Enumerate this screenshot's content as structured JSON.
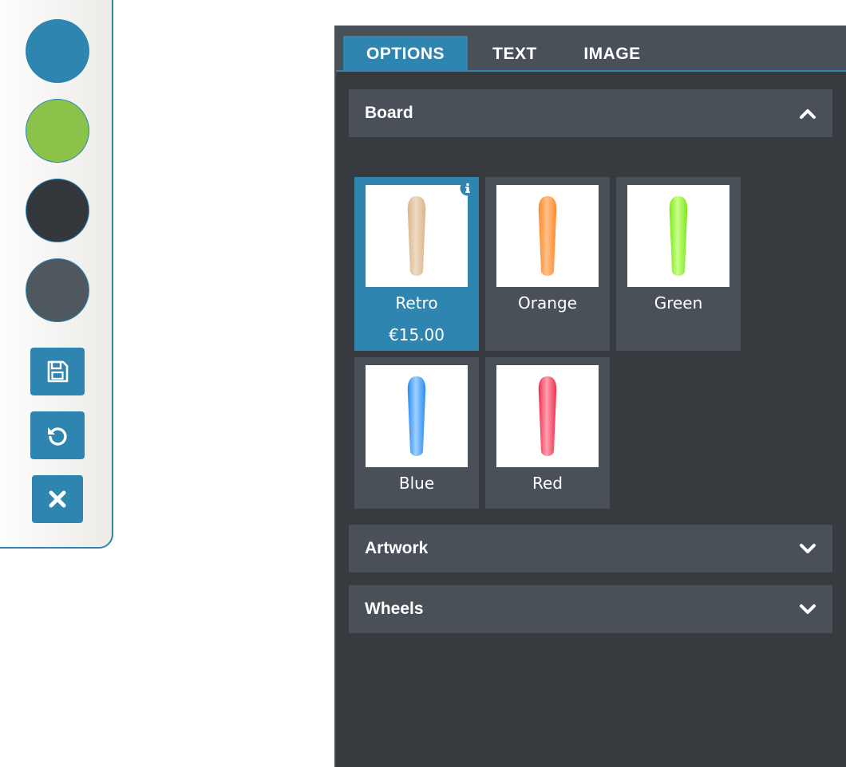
{
  "toolbar": {
    "swatches": [
      {
        "name": "blue",
        "color": "#2e86b0"
      },
      {
        "name": "green",
        "color": "#8bc34a"
      },
      {
        "name": "dark",
        "color": "#33373c"
      },
      {
        "name": "gray",
        "color": "#50585f"
      }
    ],
    "buttons": [
      {
        "icon": "save-icon"
      },
      {
        "icon": "undo-icon"
      },
      {
        "icon": "close-icon"
      }
    ],
    "accent_color": "#2e86b0"
  },
  "tabs": [
    {
      "label": "OPTIONS",
      "active": true
    },
    {
      "label": "TEXT",
      "active": false
    },
    {
      "label": "IMAGE",
      "active": false
    }
  ],
  "accordion": [
    {
      "title": "Board",
      "expanded": true
    },
    {
      "title": "Artwork",
      "expanded": false
    },
    {
      "title": "Wheels",
      "expanded": false
    }
  ],
  "board_options": [
    {
      "label": "Retro",
      "price": "€15.00",
      "selected": true,
      "color": "#d9b48a",
      "color_light": "#f0dcc4"
    },
    {
      "label": "Orange",
      "price": "",
      "selected": false,
      "color": "#ff8a2a",
      "color_light": "#ffc08a"
    },
    {
      "label": "Green",
      "price": "",
      "selected": false,
      "color": "#7ee81a",
      "color_light": "#c8ff8a"
    },
    {
      "label": "Blue",
      "price": "",
      "selected": false,
      "color": "#2a8cf0",
      "color_light": "#9fd0ff"
    },
    {
      "label": "Red",
      "price": "",
      "selected": false,
      "color": "#f0304a",
      "color_light": "#ff9fb0"
    }
  ]
}
